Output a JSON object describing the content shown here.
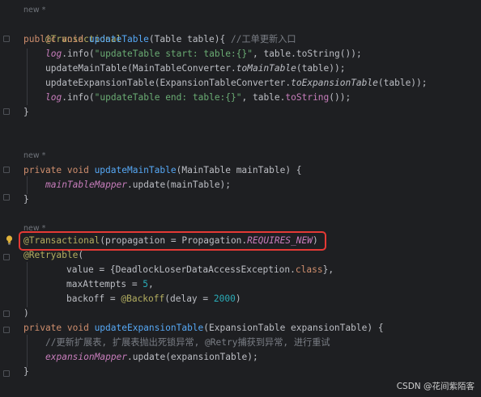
{
  "hints": {
    "h1": "new *",
    "h2": "new *",
    "h3": "new *"
  },
  "lines": {
    "l1_ann": "@Transactional",
    "l2_mod": "public void ",
    "l2_fn": "updateTable",
    "l2_rest": "(Table table){ ",
    "l2_cmt": "//工单更新入口",
    "l3_a": "log",
    "l3_b": ".info(",
    "l3_str": "\"updateTable start: table:{}\"",
    "l3_c": ", table.toString());",
    "l4_a": "updateMainTable(MainTableConverter.",
    "l4_it": "toMainTable",
    "l4_b": "(table));",
    "l5_a": "updateExpansionTable(ExpansionTableConverter.",
    "l5_it": "toExpansionTable",
    "l5_b": "(table));",
    "l6_a": "log",
    "l6_b": ".info(",
    "l6_str": "\"updateTable end: table:{}\"",
    "l6_c": ", table.",
    "l6_d": "toString",
    "l6_e": "());",
    "l7": "}",
    "l8_mod": "private void ",
    "l8_fn": "updateMainTable",
    "l8_rest": "(MainTable mainTable) {",
    "l9_a": "mainTableMapper",
    "l9_b": ".update(mainTable);",
    "l10": "}",
    "l11_ann": "@Transactional",
    "l11_rest": "(propagation = Propagation.",
    "l11_field": "REQUIRES_NEW",
    "l11_end": ")",
    "l12_ann": "@Retryable",
    "l12_rest": "(",
    "l13_a": "value = {DeadlockLoserDataAccessException.",
    "l13_kw": "class",
    "l13_b": "},",
    "l14_a": "maxAttempts = ",
    "l14_num": "5",
    "l14_b": ",",
    "l15_a": "backoff = ",
    "l15_ann": "@Backoff",
    "l15_b": "(delay = ",
    "l15_num": "2000",
    "l15_c": ")",
    "l16": ")",
    "l17_mod": "private void ",
    "l17_fn": "updateExpansionTable",
    "l17_rest": "(ExpansionTable expansionTable) {",
    "l18_cmt": "//更新扩展表, 扩展表抛出死锁异常, @Retry捕获到异常, 进行重试",
    "l19_a": "expansionMapper",
    "l19_b": ".update(expansionTable);",
    "l20": "}"
  },
  "watermark": "CSDN @花间紫陌客",
  "colors": {
    "background": "#1e1f22",
    "annotation": "#b3ae60",
    "keyword": "#cf8e6d",
    "function": "#56a8f5",
    "string": "#6aab73",
    "number": "#2aacb8",
    "comment": "#7a7e85",
    "highlight": "#e53935"
  },
  "icons": [
    "lightbulb-icon",
    "fold-marker-icon"
  ]
}
